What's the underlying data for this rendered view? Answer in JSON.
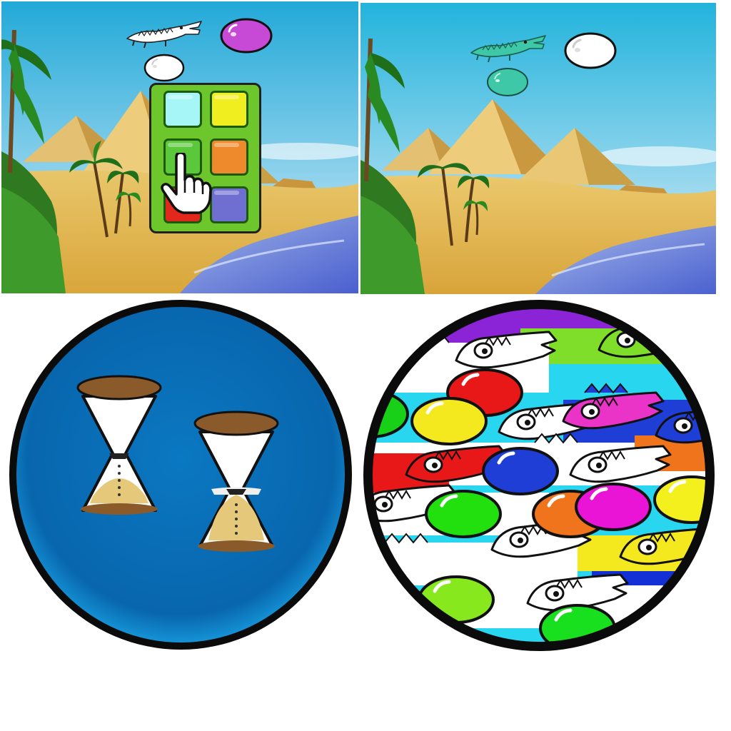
{
  "panels": [
    {
      "id": "color-select-scene",
      "scene": "egypt-desert-river",
      "characters": [
        "crocodile-icon",
        "egg-icon",
        "egg-icon"
      ],
      "colors": {
        "crocodile": "#ffffff",
        "egg_top": "#c64ad6",
        "egg_small": "#ffffff"
      },
      "color_picker": {
        "swatches": [
          {
            "name": "light-cyan",
            "color": "#a6f6f8"
          },
          {
            "name": "yellow",
            "color": "#f0ee1e"
          },
          {
            "name": "green",
            "color": "#5ac83a"
          },
          {
            "name": "orange",
            "color": "#ee8a2c"
          },
          {
            "name": "red",
            "color": "#e2281c"
          },
          {
            "name": "purple",
            "color": "#6f6fd2"
          }
        ],
        "pointer": "hand-pointer-icon"
      }
    },
    {
      "id": "colored-scene",
      "scene": "egypt-desert-river",
      "characters": [
        "crocodile-icon",
        "egg-icon",
        "egg-icon"
      ],
      "colors": {
        "crocodile": "#3ec8a8",
        "egg_top": "#ffffff",
        "egg_small": "#3ec8a8"
      }
    }
  ],
  "badges": [
    {
      "id": "timer-badge",
      "icons": [
        "hourglass-icon",
        "hourglass-icon"
      ],
      "background": "#0a6fb6"
    },
    {
      "id": "crocodile-pattern-badge",
      "icons": [
        "crocodile-icon",
        "egg-icon"
      ]
    }
  ]
}
